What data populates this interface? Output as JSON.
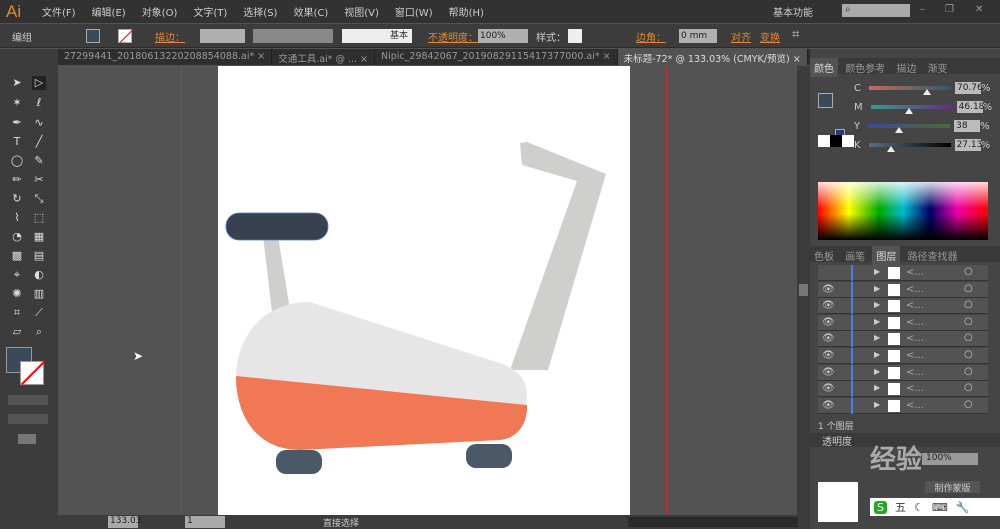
{
  "app": {
    "logo": "Ai",
    "menus": [
      "文件(F)",
      "编辑(E)",
      "对象(O)",
      "文字(T)",
      "选择(S)",
      "效果(C)",
      "视图(V)",
      "窗口(W)",
      "帮助(H)"
    ],
    "workspace": "基本功能",
    "search_placeholder": ""
  },
  "control": {
    "selection": "编组",
    "stroke_label": "描边：",
    "brush": "基本",
    "opacity_label": "不透明度：",
    "opacity": "100%",
    "style_label": "样式：",
    "corner_label": "边角：",
    "corner_value": "0 mm",
    "align": "对齐",
    "transform": "变换"
  },
  "tabs": [
    "27299441_20180613220208854088.ai* ×",
    "交通工具.ai* @ ...  ×",
    "Nipic_29842067_20190829115417377000.ai* ×",
    "未标题-72* @ 133.03% (CMYK/预览)  ×"
  ],
  "color_panel": {
    "tabs": [
      "颜色",
      "颜色参考",
      "描边",
      "渐变"
    ],
    "channels": [
      {
        "label": "C",
        "value": "70.76",
        "pct": 70.76,
        "grad": "linear-gradient(90deg,#c96a60,#2a5a70)"
      },
      {
        "label": "M",
        "value": "46.18",
        "pct": 46.18,
        "grad": "linear-gradient(90deg,#3a9a8a,#6a2a80)"
      },
      {
        "label": "Y",
        "value": "38",
        "pct": 38,
        "grad": "linear-gradient(90deg,#3a4aa0,#4a6a30)"
      },
      {
        "label": "K",
        "value": "27.13",
        "pct": 27.13,
        "grad": "linear-gradient(90deg,#5a7080,#000)"
      }
    ],
    "unit": "%",
    "fill": "#3b4a5a"
  },
  "layers_panel": {
    "tabs": [
      "色板",
      "画笔",
      "图层",
      "路径查找器"
    ],
    "row_count": 9,
    "row_label": "<...",
    "footer": "1 个图层"
  },
  "transparency": {
    "label": "透明度",
    "value": "100%",
    "make_mask": "制作蒙版",
    "clip": "剪切"
  },
  "status": {
    "zoom": "133.03",
    "page": "1",
    "tool": "直接选择"
  },
  "ime": [
    "五"
  ],
  "watermark": "经验",
  "colors": {
    "seat": "#37414f",
    "frame": "#cfcfcd",
    "body": "#e5e5e5",
    "accent": "#f07855",
    "pedal": "#4a5868"
  }
}
